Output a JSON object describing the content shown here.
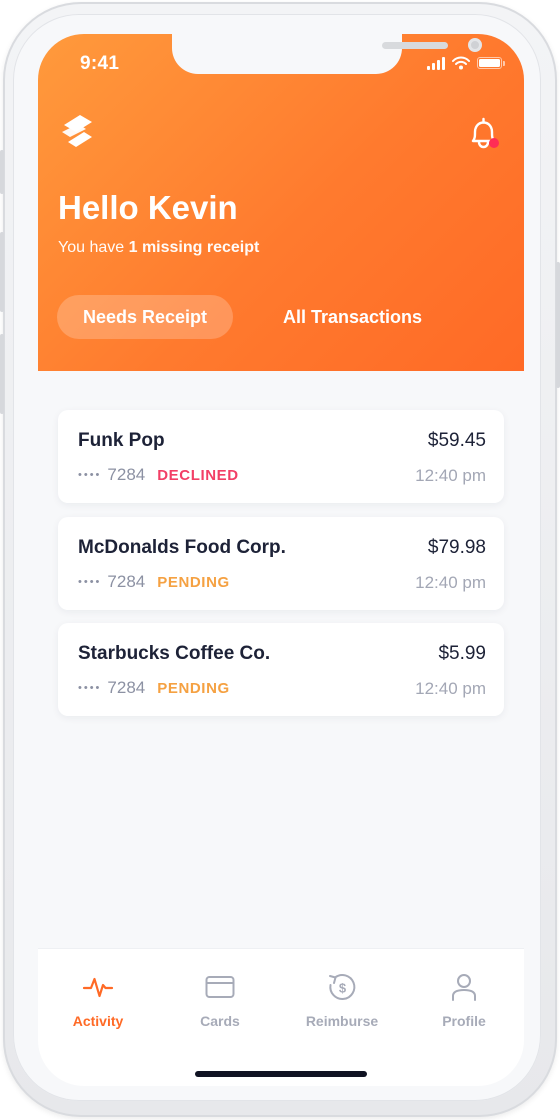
{
  "status_bar": {
    "time": "9:41"
  },
  "header": {
    "greeting": "Hello Kevin",
    "subtitle_prefix": "You have ",
    "subtitle_bold": "1 missing receipt",
    "tabs": [
      {
        "label": "Needs Receipt",
        "active": true
      },
      {
        "label": "All Transactions",
        "active": false
      }
    ]
  },
  "transactions": [
    {
      "merchant": "Funk Pop",
      "amount": "$59.45",
      "card_dots": "••••",
      "card_last4": "7284",
      "status": "DECLINED",
      "time": "12:40 pm"
    },
    {
      "merchant": "McDonalds Food Corp.",
      "amount": "$79.98",
      "card_dots": "••••",
      "card_last4": "7284",
      "status": "PENDING",
      "time": "12:40 pm"
    },
    {
      "merchant": "Starbucks Coffee Co.",
      "amount": "$5.99",
      "card_dots": "••••",
      "card_last4": "7284",
      "status": "PENDING",
      "time": "12:40 pm"
    }
  ],
  "bottom_nav": [
    {
      "label": "Activity",
      "icon": "activity-icon",
      "active": true
    },
    {
      "label": "Cards",
      "icon": "card-icon",
      "active": false
    },
    {
      "label": "Reimburse",
      "icon": "reimburse-icon",
      "active": false
    },
    {
      "label": "Profile",
      "icon": "profile-icon",
      "active": false
    }
  ],
  "colors": {
    "brand_orange": "#ff7a2e",
    "declined": "#f23f66",
    "pending": "#f5a142",
    "notification_dot": "#ff2d55"
  }
}
